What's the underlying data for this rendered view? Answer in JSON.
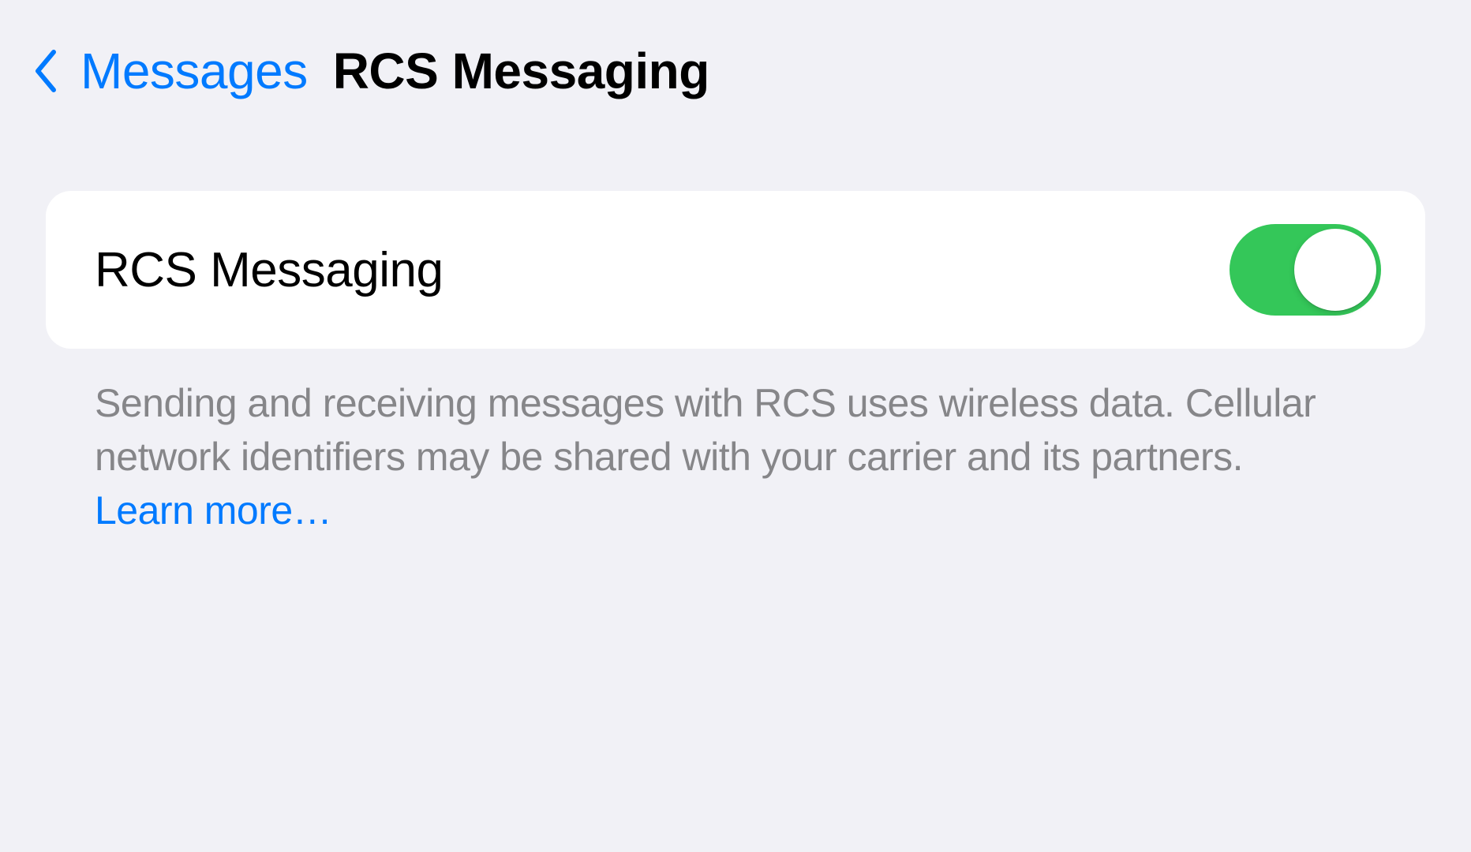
{
  "nav": {
    "back_label": "Messages",
    "title": "RCS Messaging"
  },
  "setting": {
    "label": "RCS Messaging",
    "toggle_on": true
  },
  "footer": {
    "description": "Sending and receiving messages with RCS uses wireless data. Cellular network identifiers may be shared with your carrier and its partners.",
    "learn_more": "Learn more…"
  },
  "colors": {
    "accent": "#007aff",
    "toggle_on": "#34c759",
    "bg": "#f1f1f6",
    "card": "#ffffff",
    "secondary_text": "#868689"
  }
}
